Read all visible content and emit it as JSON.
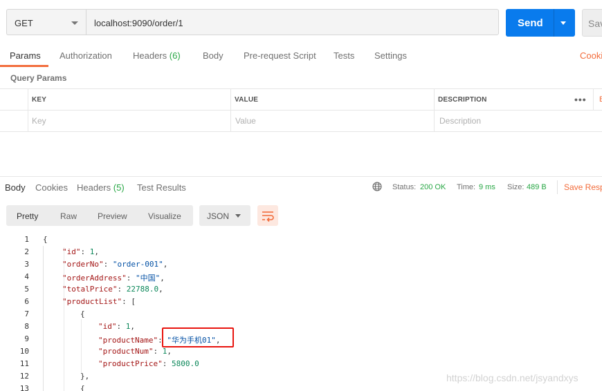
{
  "request": {
    "method": "GET",
    "url": "localhost:9090/order/1",
    "send_label": "Send",
    "save_label": "Save"
  },
  "request_tabs": [
    {
      "label": "Params",
      "count": ""
    },
    {
      "label": "Authorization",
      "count": ""
    },
    {
      "label": "Headers",
      "count": "(6)"
    },
    {
      "label": "Body",
      "count": ""
    },
    {
      "label": "Pre-request Script",
      "count": ""
    },
    {
      "label": "Tests",
      "count": ""
    },
    {
      "label": "Settings",
      "count": ""
    }
  ],
  "cookies_label": "Cookies",
  "query_params": {
    "title": "Query Params",
    "columns": [
      "KEY",
      "VALUE",
      "DESCRIPTION"
    ],
    "placeholders": [
      "Key",
      "Value",
      "Description"
    ],
    "bulk_edit_label": "Bulk Edit"
  },
  "response_tabs": [
    {
      "label": "Body",
      "count": ""
    },
    {
      "label": "Cookies",
      "count": ""
    },
    {
      "label": "Headers",
      "count": "(5)"
    },
    {
      "label": "Test Results",
      "count": ""
    }
  ],
  "status": {
    "status_label": "Status:",
    "status_value": "200 OK",
    "time_label": "Time:",
    "time_value": "9 ms",
    "size_label": "Size:",
    "size_value": "489 B",
    "save_response_label": "Save Response"
  },
  "view_modes": [
    "Pretty",
    "Raw",
    "Preview",
    "Visualize"
  ],
  "format": "JSON",
  "code_lines": [
    {
      "n": "1"
    },
    {
      "n": "2"
    },
    {
      "n": "3"
    },
    {
      "n": "4"
    },
    {
      "n": "5"
    },
    {
      "n": "6"
    },
    {
      "n": "7"
    },
    {
      "n": "8"
    },
    {
      "n": "9"
    },
    {
      "n": "10"
    },
    {
      "n": "11"
    },
    {
      "n": "12"
    },
    {
      "n": "13"
    }
  ],
  "json": {
    "id_key": "\"id\"",
    "id_val": "1",
    "orderNo_key": "\"orderNo\"",
    "orderNo_val": "\"order-001\"",
    "orderAddress_key": "\"orderAddress\"",
    "orderAddress_val": "\"中国\"",
    "totalPrice_key": "\"totalPrice\"",
    "totalPrice_val": "22788.0",
    "productList_key": "\"productList\"",
    "p_id_key": "\"id\"",
    "p_id_val": "1",
    "productName_key": "\"productName\"",
    "productName_val": "\"华为手机01\"",
    "productNum_key": "\"productNum\"",
    "productNum_val": "1",
    "productPrice_key": "\"productPrice\"",
    "productPrice_val": "5800.0"
  },
  "watermark": "https://blog.csdn.net/jsyandxys",
  "colors": {
    "accent": "#f26b3a",
    "send": "#097bed",
    "ok": "#28a745",
    "highlight": "#e8140e"
  }
}
